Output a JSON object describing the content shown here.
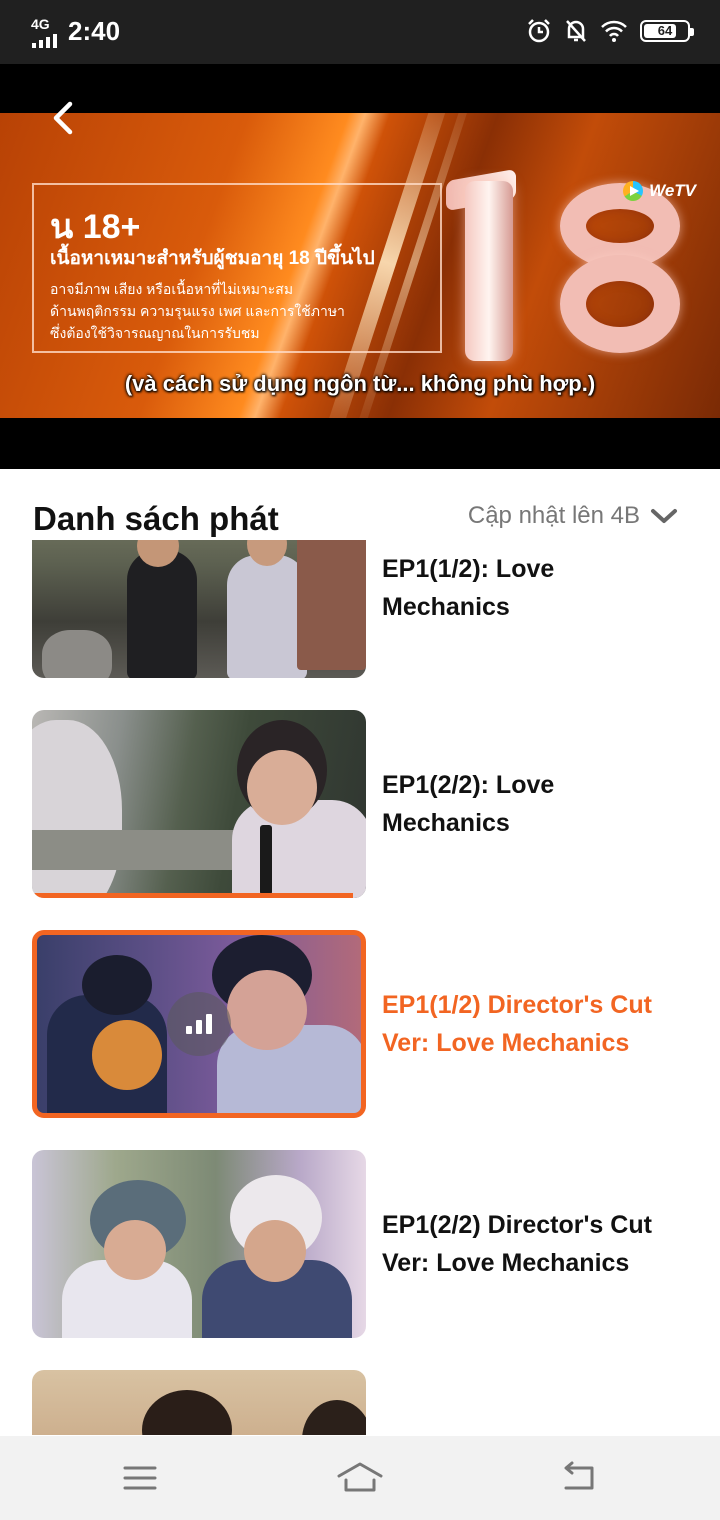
{
  "status_bar": {
    "network": "4G",
    "time": "2:40",
    "battery": "64",
    "battery_level": 0.64
  },
  "player": {
    "rating_title": "น 18+",
    "rating_subtitle": "เนื้อหาเหมาะสำหรับผู้ชมอายุ 18 ปีขึ้นไป",
    "rating_desc": [
      "อาจมีภาพ เสียง หรือเนื้อหาที่ไม่เหมาะสม",
      "ด้านพฤติกรรม ความรุนแรง เพศ และการใช้ภาษา",
      "ซึ่งต้องใช้วิจารณญาณในการรับชม"
    ],
    "subtitle": "(và cách sử dụng ngôn từ... không phù hợp.)",
    "watermark": "WeTV"
  },
  "playlist": {
    "title": "Danh sách phát",
    "update_label": "Cập nhật lên 4B",
    "accent_color": "#f26522",
    "episodes": [
      {
        "title": "EP1(1/2): Love Mechanics",
        "state": "normal"
      },
      {
        "title": "EP1(2/2): Love Mechanics",
        "state": "watched",
        "progress": 0.96
      },
      {
        "title": "EP1(1/2) Director's Cut Ver: Love Mechanics",
        "state": "playing"
      },
      {
        "title": "EP1(2/2) Director's Cut Ver: Love Mechanics",
        "state": "normal"
      },
      {
        "title": "",
        "state": "normal"
      }
    ]
  },
  "nav_bar": {
    "icons": [
      "menu-icon",
      "home-icon",
      "back-icon"
    ]
  }
}
